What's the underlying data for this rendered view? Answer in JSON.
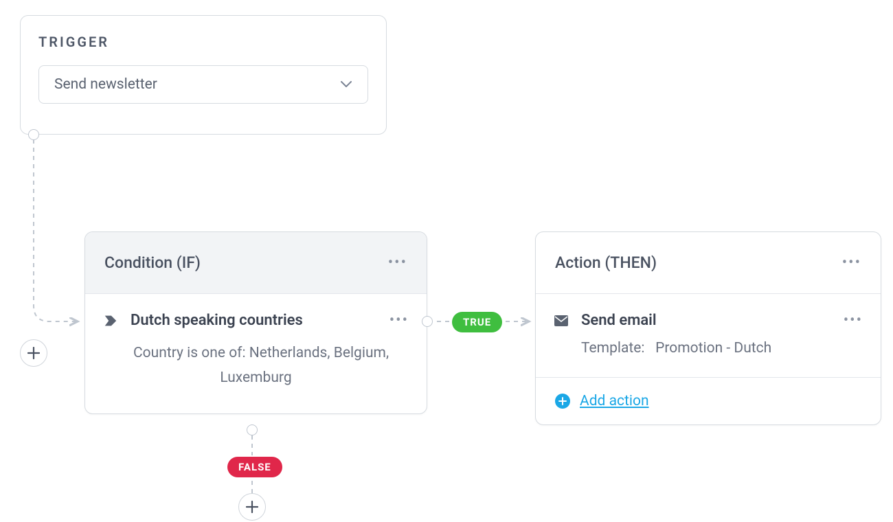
{
  "trigger": {
    "title": "TRIGGER",
    "selected": "Send newsletter"
  },
  "condition": {
    "title": "Condition (IF)",
    "name": "Dutch speaking countries",
    "description_line1": "Country  is one of:  Netherlands, Belgium,",
    "description_line2": "Luxemburg"
  },
  "action": {
    "title": "Action (THEN)",
    "name": "Send email",
    "template_label": "Template:",
    "template_value": "Promotion - Dutch",
    "add_action_label": "Add action"
  },
  "labels": {
    "true": "TRUE",
    "false": "FALSE"
  }
}
